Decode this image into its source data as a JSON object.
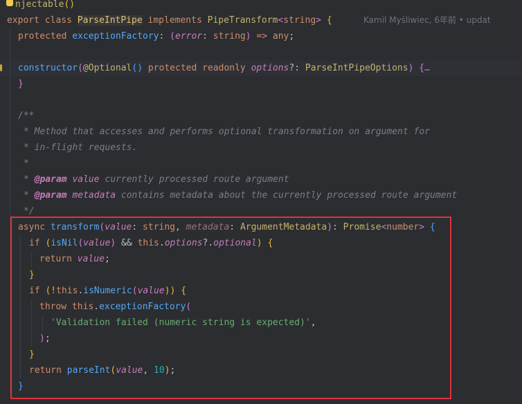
{
  "editor": {
    "blame": "Kamil Myśliwiec, 6年前 • updat",
    "lines": {
      "l0": [
        "njectable",
        "()"
      ],
      "l1": [
        "export",
        "class",
        "ParseIntPipe",
        "implements",
        "PipeTransform",
        "<",
        "string",
        ">",
        "{"
      ],
      "l2": [
        "protected",
        "exceptionFactory",
        ":",
        "(",
        "error",
        ":",
        "string",
        ")",
        "=>",
        "any",
        ";"
      ],
      "l4": [
        "constructor",
        "(",
        "@",
        "Optional",
        "()",
        "protected",
        "readonly",
        "options",
        "?:",
        "ParseIntPipeOptions",
        ")",
        "{",
        "…"
      ],
      "l5": [
        "}"
      ],
      "l7": [
        "/**"
      ],
      "l8": [
        "* Method that accesses and performs optional transformation on argument for"
      ],
      "l9": [
        "* in-flight requests."
      ],
      "l10": [
        "*"
      ],
      "l11": [
        "*",
        "@param",
        "value",
        "currently processed route argument"
      ],
      "l12": [
        "*",
        "@param",
        "metadata",
        "contains metadata about the currently processed route argument"
      ],
      "l13": [
        "*/"
      ],
      "l14": [
        "async",
        "transform",
        "(",
        "value",
        ":",
        "string",
        ",",
        "metadata",
        ":",
        "ArgumentMetadata",
        ")",
        ":",
        "Promise",
        "<",
        "number",
        ">",
        "{"
      ],
      "l15": [
        "if",
        "(",
        "isNil",
        "(",
        "value",
        ")",
        "&&",
        "this",
        ".",
        "options",
        "?.",
        "optional",
        ")",
        "{"
      ],
      "l16": [
        "return",
        "value",
        ";"
      ],
      "l17": [
        "}"
      ],
      "l18": [
        "if",
        "(!",
        "this",
        ".",
        "isNumeric",
        "(",
        "value",
        "))",
        "{"
      ],
      "l19": [
        "throw",
        "this",
        ".",
        "exceptionFactory",
        "("
      ],
      "l20": [
        "'Validation failed (numeric string is expected)'",
        ","
      ],
      "l21": [
        ")",
        ";"
      ],
      "l22": [
        "}"
      ],
      "l23": [
        "return",
        "parseInt",
        "(",
        "value",
        ",",
        "10",
        ")",
        ";"
      ],
      "l24": [
        "}"
      ]
    }
  },
  "colors": {
    "background": "#2b2d30",
    "keyword": "#cf8e6d",
    "function": "#56a8f5",
    "string": "#6aab73",
    "number": "#2aacb8",
    "comment": "#7a7e85",
    "param": "#c77dbb",
    "highlight_box": "#e0323c"
  },
  "icons": {
    "intention": "lightbulb-icon",
    "fold": "ellipsis-fold-icon"
  }
}
